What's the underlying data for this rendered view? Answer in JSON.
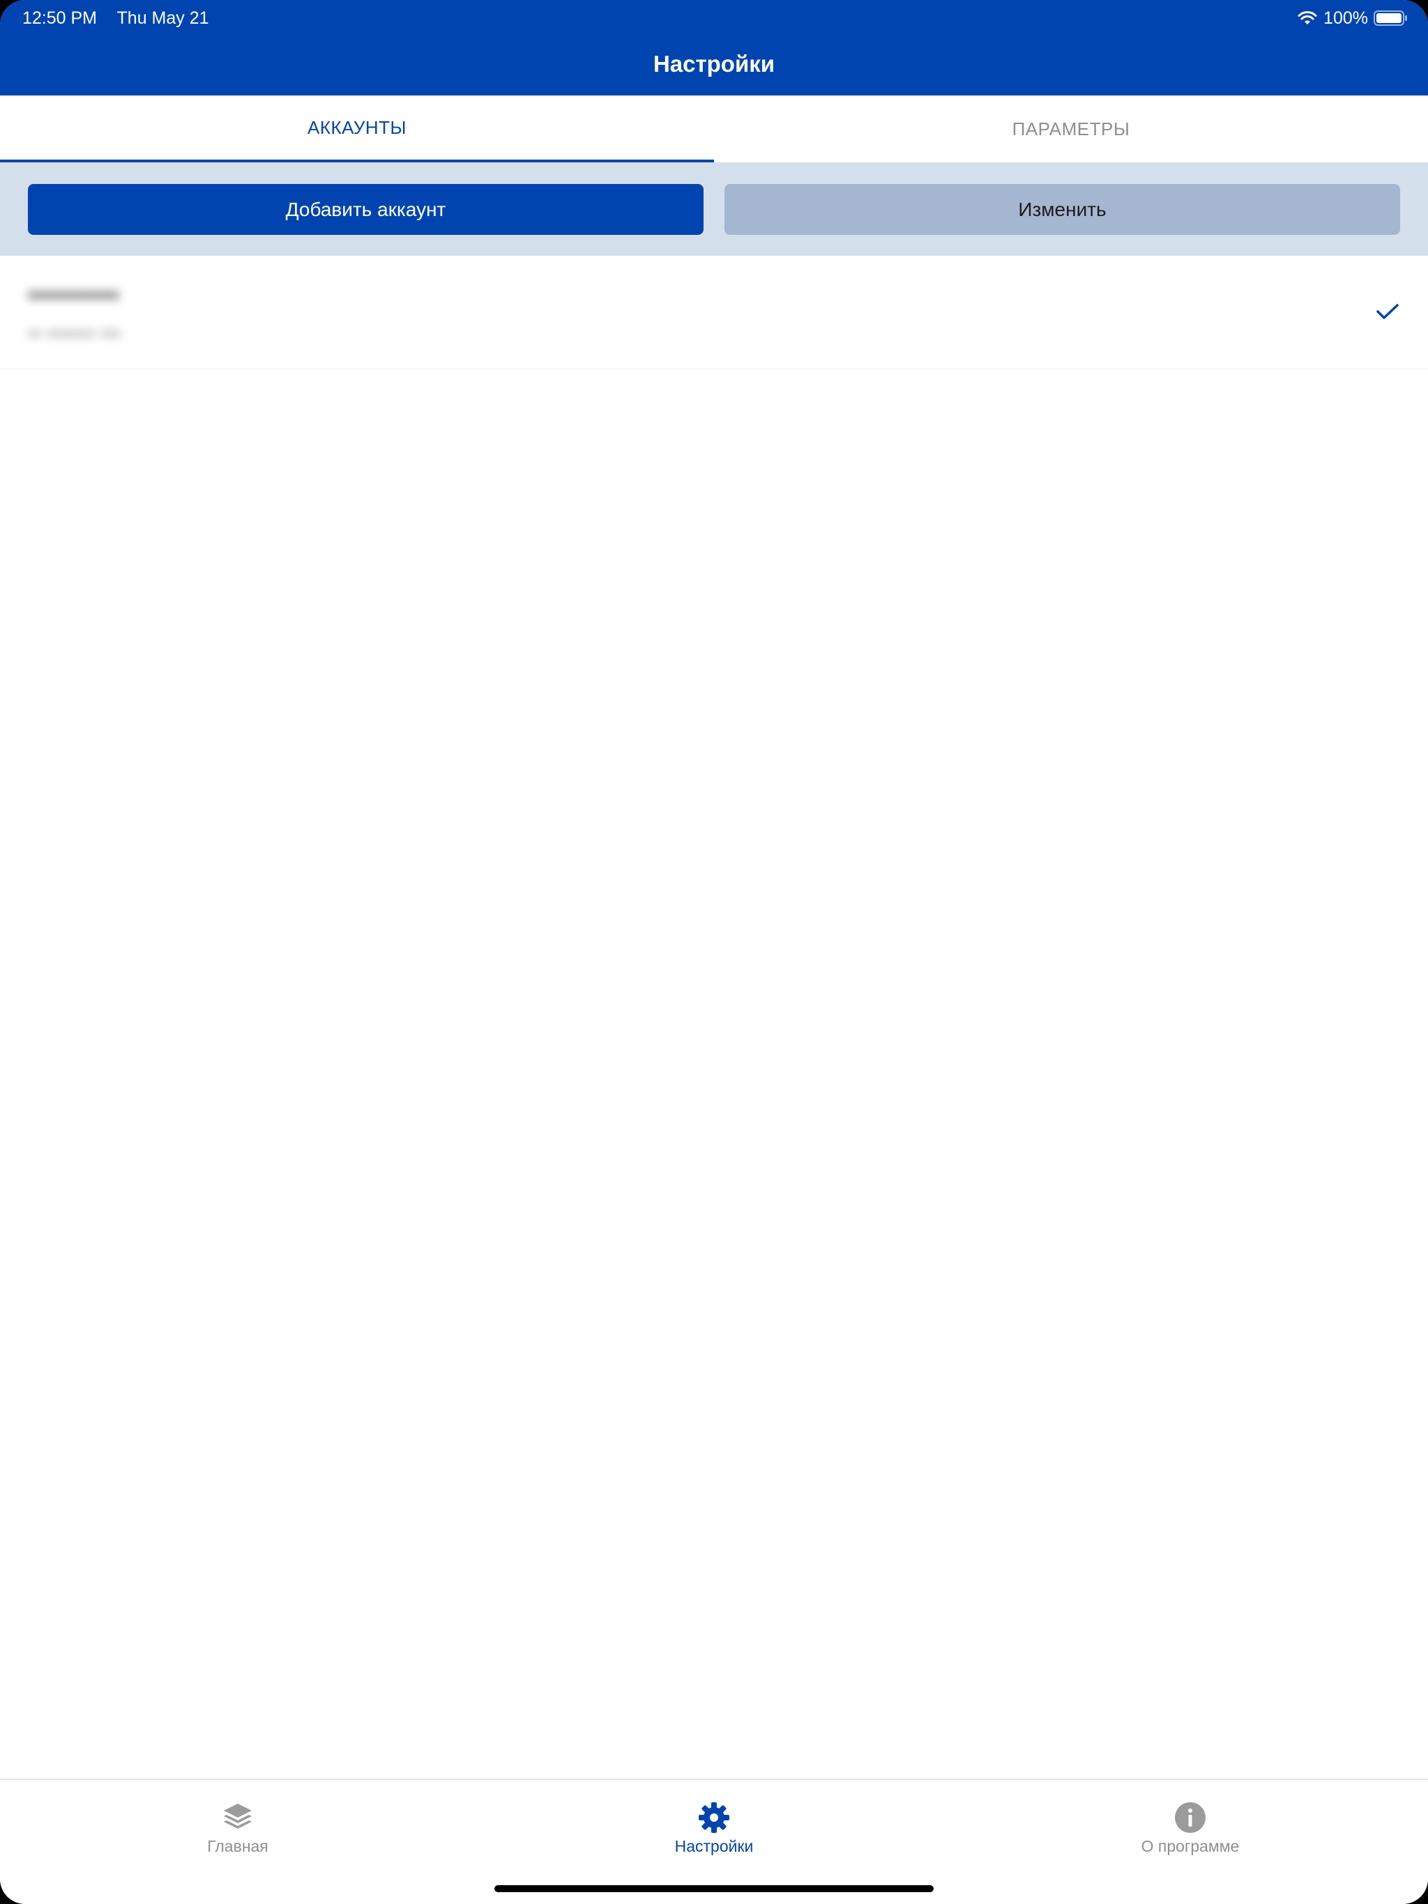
{
  "status_bar": {
    "time": "12:50 PM",
    "date": "Thu May 21",
    "battery": "100%"
  },
  "nav": {
    "title": "Настройки"
  },
  "tabs": [
    {
      "label": "АККАУНТЫ",
      "active": true
    },
    {
      "label": "ПАРАМЕТРЫ",
      "active": false
    }
  ],
  "toolbar": {
    "add_label": "Добавить аккаунт",
    "edit_label": "Изменить"
  },
  "accounts": [
    {
      "name": "•••••••••••",
      "subtitle": "•• ••••••• •••",
      "selected": true
    }
  ],
  "tabbar": {
    "items": [
      {
        "label": "Главная",
        "icon": "layers-icon",
        "active": false
      },
      {
        "label": "Настройки",
        "icon": "gear-icon",
        "active": true
      },
      {
        "label": "О программе",
        "icon": "info-icon",
        "active": false
      }
    ]
  },
  "colors": {
    "brand": "#0044b0",
    "toolbar_bg": "#d3dfea",
    "disabled_button": "#a5b6d0",
    "inactive": "#8e8e93"
  }
}
